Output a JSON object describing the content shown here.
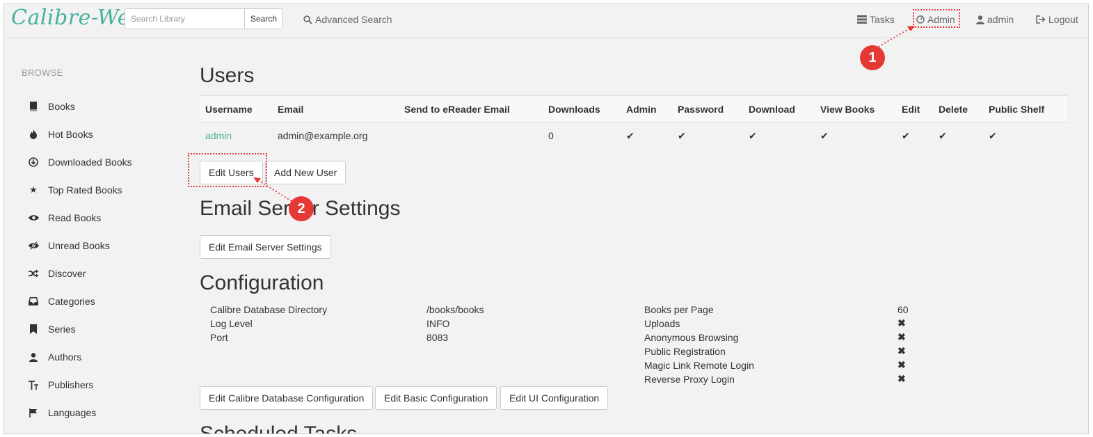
{
  "navbar": {
    "brand": "Calibre-Web",
    "search_placeholder": "Search Library",
    "search_button": "Search",
    "advanced_search": "Advanced Search",
    "tasks": "Tasks",
    "admin": "Admin",
    "user": "admin",
    "logout": "Logout"
  },
  "callouts": {
    "one": "1",
    "two": "2"
  },
  "sidebar": {
    "header": "BROWSE",
    "items": [
      {
        "label": "Books",
        "icon": "book-icon"
      },
      {
        "label": "Hot Books",
        "icon": "fire-icon"
      },
      {
        "label": "Downloaded Books",
        "icon": "download-circle-icon"
      },
      {
        "label": "Top Rated Books",
        "icon": "star-icon"
      },
      {
        "label": "Read Books",
        "icon": "eye-icon"
      },
      {
        "label": "Unread Books",
        "icon": "eye-slash-icon"
      },
      {
        "label": "Discover",
        "icon": "shuffle-icon"
      },
      {
        "label": "Categories",
        "icon": "inbox-icon"
      },
      {
        "label": "Series",
        "icon": "bookmark-icon"
      },
      {
        "label": "Authors",
        "icon": "user-icon"
      },
      {
        "label": "Publishers",
        "icon": "text-height-icon"
      },
      {
        "label": "Languages",
        "icon": "flag-icon"
      }
    ]
  },
  "users": {
    "title": "Users",
    "columns": [
      "Username",
      "Email",
      "Send to eReader Email",
      "Downloads",
      "Admin",
      "Password",
      "Download",
      "View Books",
      "Edit",
      "Delete",
      "Public Shelf"
    ],
    "rows": [
      {
        "username": "admin",
        "email": "admin@example.org",
        "ereader": "",
        "downloads": "0",
        "check": "✔"
      }
    ],
    "edit_button": "Edit Users",
    "add_button": "Add New User"
  },
  "email": {
    "title": "Email Server Settings",
    "edit_button": "Edit Email Server Settings"
  },
  "config": {
    "title": "Configuration",
    "left": [
      {
        "label": "Calibre Database Directory",
        "value": "/books/books"
      },
      {
        "label": "Log Level",
        "value": "INFO"
      },
      {
        "label": "Port",
        "value": "8083"
      }
    ],
    "right": [
      {
        "label": "Books per Page",
        "value": "60"
      },
      {
        "label": "Uploads",
        "value": "✖"
      },
      {
        "label": "Anonymous Browsing",
        "value": "✖"
      },
      {
        "label": "Public Registration",
        "value": "✖"
      },
      {
        "label": "Magic Link Remote Login",
        "value": "✖"
      },
      {
        "label": "Reverse Proxy Login",
        "value": "✖"
      }
    ],
    "buttons": [
      "Edit Calibre Database Configuration",
      "Edit Basic Configuration",
      "Edit UI Configuration"
    ]
  },
  "scheduled": {
    "title": "Scheduled Tasks"
  },
  "colors": {
    "accent": "#45b29d",
    "annotation": "#e53935",
    "background": "#f2f2f2"
  }
}
